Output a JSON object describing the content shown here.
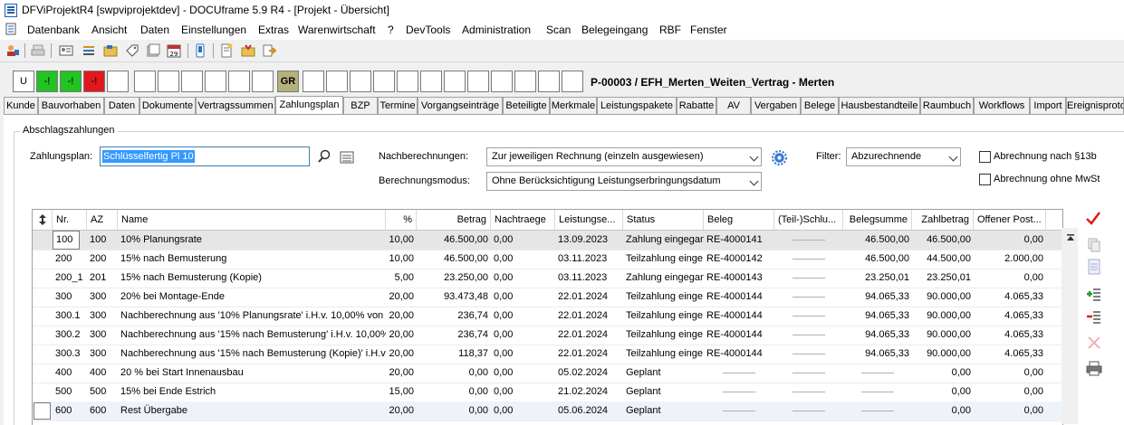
{
  "window": {
    "title": "DFViProjektR4 [swpviprojektdev] - DOCUframe 5.9 R4 - [Projekt - Übersicht]"
  },
  "menu": [
    "Datenbank",
    "Ansicht",
    "Daten",
    "Einstellungen",
    "Extras",
    "Warenwirtschaft",
    "?",
    "DevTools",
    "Administration",
    "Scan",
    "Belegeingang",
    "RBF",
    "Fenster"
  ],
  "status_boxes": {
    "u": "U",
    "g1": "-!",
    "g2": "-!",
    "r1": "-!",
    "gr": "GR"
  },
  "project_title": "P-00003 / EFH_Merten_Weiten_Vertrag - Merten",
  "tabs": [
    "Kunde",
    "Bauvorhaben",
    "Daten",
    "Dokumente",
    "Vertragssummen",
    "Zahlungsplan",
    "BZP",
    "Termine",
    "Vorgangseinträge",
    "Beteiligte",
    "Merkmale",
    "Leistungspakete",
    "Rabatte",
    "AV",
    "Vergaben",
    "Belege",
    "Hausbestandteile",
    "Raumbuch",
    "Workflows",
    "Import",
    "Ereignisproto"
  ],
  "section": {
    "title": "Abschlagszahlungen"
  },
  "form": {
    "zahlungsplan_label": "Zahlungsplan:",
    "zahlungsplan_value": "Schlüsselfertig Pl 10",
    "nachberechnungen_label": "Nachberechnungen:",
    "nachberechnungen_value": "Zur jeweiligen Rechnung (einzeln ausgewiesen)",
    "berechnungsmodus_label": "Berechnungsmodus:",
    "berechnungsmodus_value": "Ohne Berücksichtigung Leistungserbringungsdatum",
    "filter_label": "Filter:",
    "filter_value": "Abzurechnende",
    "chk_13b": "Abrechnung nach §13b",
    "chk_mwst": "Abrechnung ohne MwSt"
  },
  "table": {
    "headers": [
      "Nr.",
      "AZ",
      "Name",
      "%",
      "Betrag",
      "Nachtraege",
      "Leistungse...",
      "Status",
      "Beleg",
      "(Teil-)Schlu...",
      "Belegsumme",
      "Zahlbetrag",
      "Offener Post..."
    ],
    "rows": [
      [
        "100",
        "100",
        "10% Planungsrate",
        "10,00",
        "46.500,00",
        "0,00",
        "13.09.2023",
        "Zahlung eingegan",
        "RE-4000141",
        "-",
        "46.500,00",
        "46.500,00",
        "0,00"
      ],
      [
        "200",
        "200",
        "15% nach Bemusterung",
        "10,00",
        "46.500,00",
        "0,00",
        "03.11.2023",
        "Teilzahlung einge",
        "RE-4000142",
        "-",
        "46.500,00",
        "44.500,00",
        "2.000,00"
      ],
      [
        "200_1",
        "201",
        "15% nach Bemusterung (Kopie)",
        "5,00",
        "23.250,00",
        "0,00",
        "03.11.2023",
        "Zahlung eingegan",
        "RE-4000143",
        "-",
        "23.250,01",
        "23.250,01",
        "0,00"
      ],
      [
        "300",
        "300",
        "20% bei Montage-Ende",
        "20,00",
        "93.473,48",
        "0,00",
        "22.01.2024",
        "Teilzahlung einge",
        "RE-4000144",
        "-",
        "94.065,33",
        "90.000,00",
        "4.065,33"
      ],
      [
        "300.1",
        "300",
        "Nachberechnung aus '10% Planungsrate' i.H.v. 10,00% von",
        "20,00",
        "236,74",
        "0,00",
        "22.01.2024",
        "Teilzahlung einge",
        "RE-4000144",
        "-",
        "94.065,33",
        "90.000,00",
        "4.065,33"
      ],
      [
        "300.2",
        "300",
        "Nachberechnung aus '15% nach Bemusterung' i.H.v. 10,00%",
        "20,00",
        "236,74",
        "0,00",
        "22.01.2024",
        "Teilzahlung einge",
        "RE-4000144",
        "-",
        "94.065,33",
        "90.000,00",
        "4.065,33"
      ],
      [
        "300.3",
        "300",
        "Nachberechnung aus '15% nach Bemusterung (Kopie)' i.H.v",
        "20,00",
        "118,37",
        "0,00",
        "22.01.2024",
        "Teilzahlung einge",
        "RE-4000144",
        "-",
        "94.065,33",
        "90.000,00",
        "4.065,33"
      ],
      [
        "400",
        "400",
        "20 % bei Start Innenausbau",
        "20,00",
        "0,00",
        "0,00",
        "05.02.2024",
        "Geplant",
        "-",
        "-",
        "-",
        "0,00",
        "0,00"
      ],
      [
        "500",
        "500",
        "15% bei Ende Estrich",
        "15,00",
        "0,00",
        "0,00",
        "21.02.2024",
        "Geplant",
        "-",
        "-",
        "-",
        "0,00",
        "0,00"
      ],
      [
        "600",
        "600",
        "Rest Übergabe",
        "20,00",
        "0,00",
        "0,00",
        "05.06.2024",
        "Geplant",
        "-",
        "-",
        "-",
        "0,00",
        "0,00"
      ]
    ]
  },
  "colors": {
    "green": "#22c322",
    "red": "#e0191c",
    "gr": "#b5b07c",
    "accent": "#3399ff",
    "check_red": "#e0191c"
  }
}
